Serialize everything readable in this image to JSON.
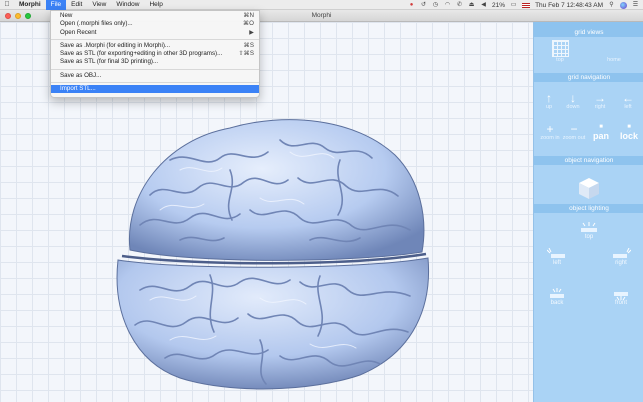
{
  "menubar": {
    "apple_icon": "apple-icon",
    "app_name": "Morphi",
    "menus": [
      "File",
      "Edit",
      "View",
      "Window",
      "Help"
    ],
    "status": {
      "battery": "21%",
      "clock": "Thu Feb 7  12:48:43 AM"
    }
  },
  "window": {
    "title": "Morphi"
  },
  "file_menu": {
    "items": [
      {
        "label": "New",
        "shortcut": "⌘N"
      },
      {
        "label": "Open (.morphi files only)...",
        "shortcut": "⌘O"
      },
      {
        "label": "Open Recent",
        "shortcut": "▶"
      },
      {
        "label": "Save as .Morphi (for editing in Morphi)...",
        "shortcut": "⌘S"
      },
      {
        "label": "Save as STL (for exporting+editing in other 3D programs)...",
        "shortcut": "⇧⌘S"
      },
      {
        "label": "Save as STL (for final 3D printing)...",
        "shortcut": ""
      },
      {
        "label": "Save as OBJ...",
        "shortcut": ""
      },
      {
        "label": "Import STL...",
        "shortcut": ""
      }
    ]
  },
  "panel": {
    "sections": {
      "grid_views": "grid views",
      "grid_navigation": "grid navigation",
      "object_navigation": "object navigation",
      "object_lighting": "object lighting"
    },
    "grid_views": {
      "top": "top",
      "home": "home"
    },
    "navigation": {
      "up": "up",
      "down": "down",
      "right": "right",
      "left": "left",
      "zoom_in": "zoom in",
      "zoom_out": "zoom out",
      "pan": "pan",
      "lock": "lock"
    },
    "lighting": {
      "top": "top",
      "left": "left",
      "right": "right",
      "back": "back",
      "front": "front"
    }
  },
  "colors": {
    "accent": "#3b82f6",
    "panel": "#aad3f5",
    "brain": "#b9cef0"
  }
}
